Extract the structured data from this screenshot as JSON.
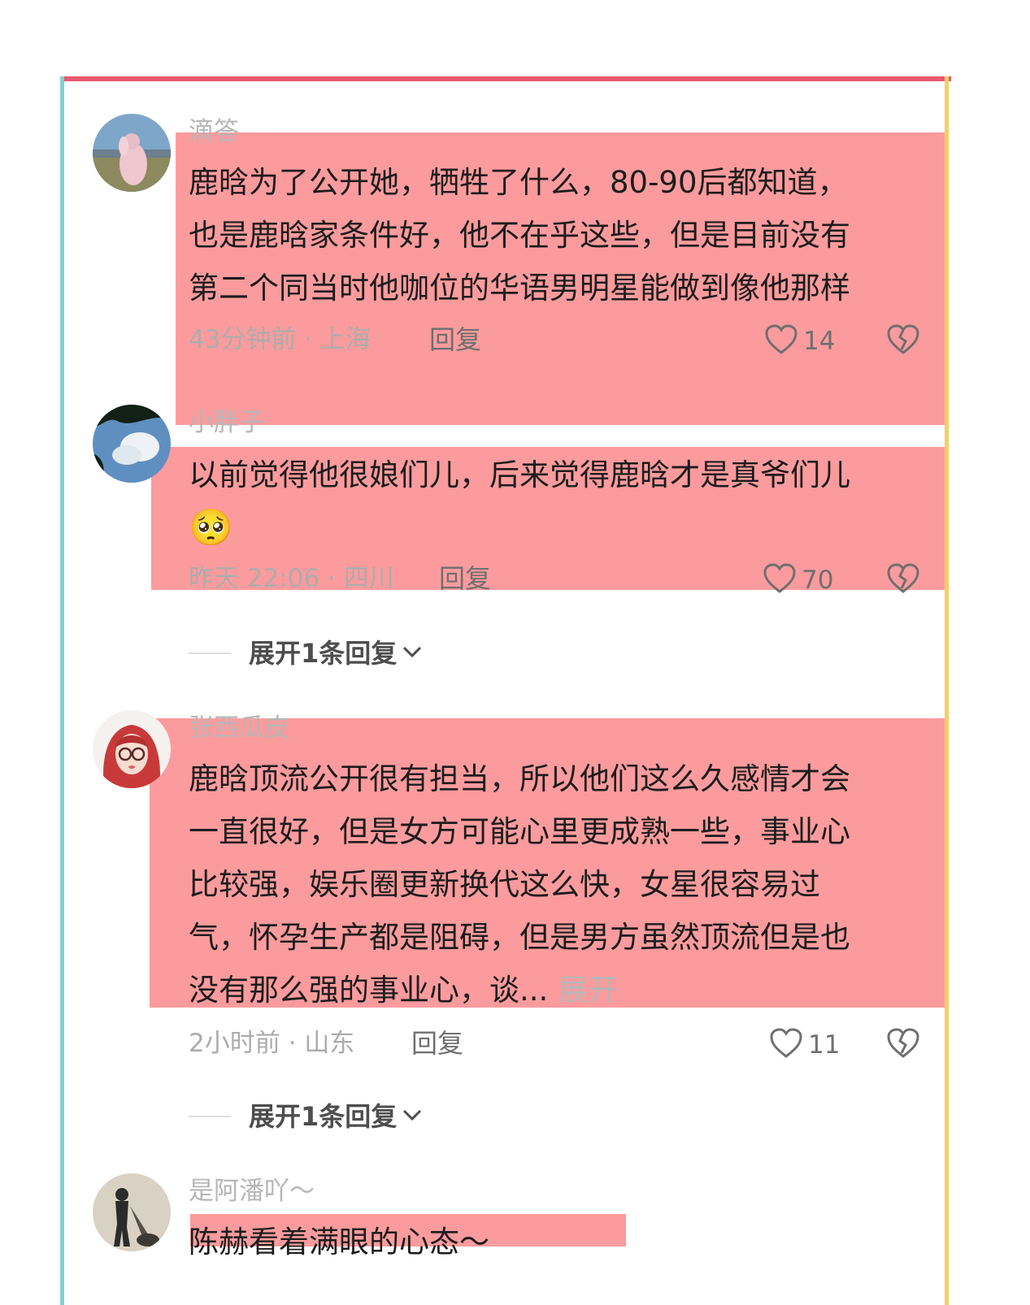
{
  "comments": [
    {
      "username": "滴答",
      "lines": [
        "鹿晗为了公开她，牺牲了什么，80-90后都知道，",
        "也是鹿晗家条件好，他不在乎这些，但是目前没有",
        "第二个同当时他咖位的华语男明星能做到像他那样"
      ],
      "meta": "43分钟前 · 上海",
      "reply_label": "回复",
      "likes": "14"
    },
    {
      "username": "小胖子",
      "lines": [
        "以前觉得他很娘们儿，后来觉得鹿晗才是真爷们儿"
      ],
      "emoji": "🥺",
      "meta": "昨天 22:06 · 四川",
      "reply_label": "回复",
      "likes": "70",
      "expand_label": "展开1条回复"
    },
    {
      "username": "张西瓜皮",
      "lines": [
        "鹿晗顶流公开很有担当，所以他们这么久感情才会",
        "一直很好，但是女方可能心里更成熟一些，事业心",
        "比较强，娱乐圈更新换代这么快，女星很容易过",
        "气，怀孕生产都是阻碍，但是男方虽然顶流但是也",
        "没有那么强的事业心，谈..."
      ],
      "more_label": "展开",
      "meta": "2小时前 · 山东",
      "reply_label": "回复",
      "likes": "11",
      "expand_label": "展开1条回复"
    },
    {
      "username": "是阿潘吖～",
      "lines": [
        "陈赫看着满眼的心态～"
      ]
    }
  ],
  "colors": {
    "highlight": "#fc9b9d",
    "frame_top": "#e9596f",
    "frame_left": "#86cfd3",
    "frame_right": "#f6cf62"
  },
  "icons": [
    "heart-outline-icon",
    "broken-heart-icon",
    "chevron-down-icon"
  ]
}
